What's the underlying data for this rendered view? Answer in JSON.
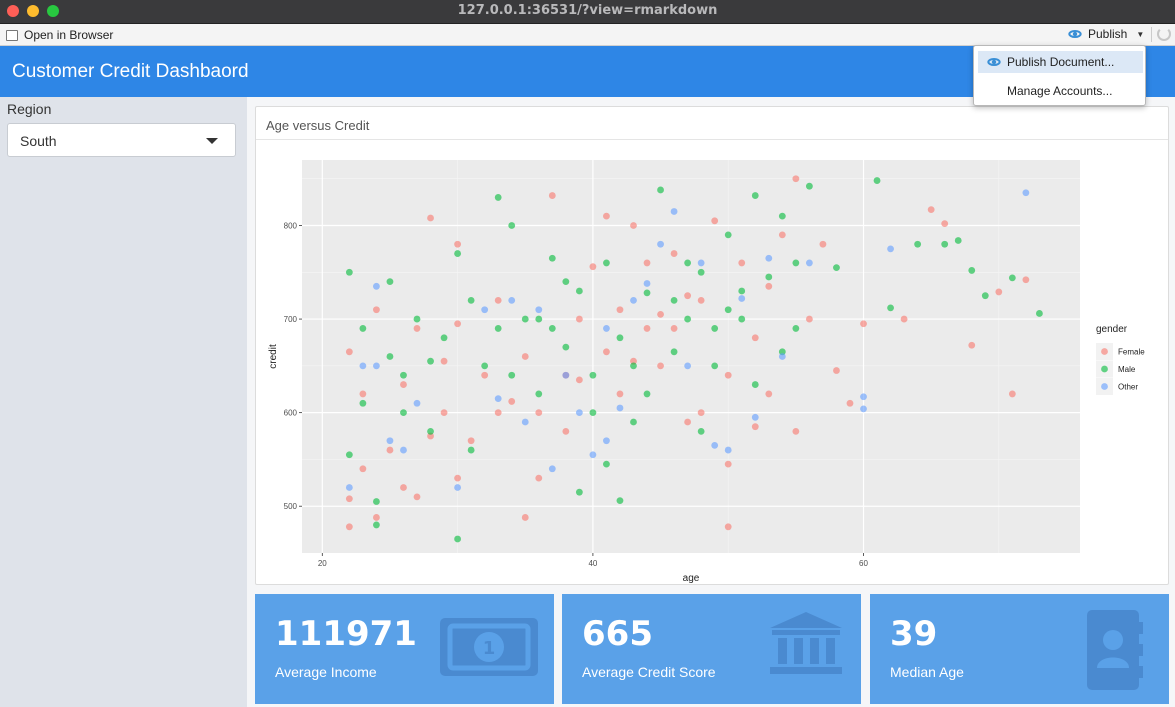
{
  "window": {
    "url": "127.0.0.1:36531/?view=rmarkdown"
  },
  "toolbar": {
    "open_browser": "Open in Browser",
    "publish": "Publish"
  },
  "publish_menu": {
    "items": [
      "Publish Document...",
      "Manage Accounts..."
    ]
  },
  "header": {
    "title": "Customer Credit Dashbaord"
  },
  "sidebar": {
    "region_label": "Region",
    "region_value": "South"
  },
  "plot_card": {
    "title": "Age versus Credit"
  },
  "value_boxes": [
    {
      "value": "111971",
      "label": "Average Income",
      "icon": "money-bill-icon"
    },
    {
      "value": "665",
      "label": "Average Credit Score",
      "icon": "bank-icon"
    },
    {
      "value": "39",
      "label": "Median Age",
      "icon": "address-book-icon"
    }
  ],
  "colors": {
    "header": "#2e86e6",
    "value_box": "#5aa1e8",
    "female": "#f8766d",
    "male": "#00ba38",
    "other": "#619cff"
  },
  "chart_data": {
    "type": "scatter",
    "xlabel": "age",
    "ylabel": "credit",
    "xlim": [
      18.5,
      76
    ],
    "ylim": [
      450,
      870
    ],
    "x_ticks": [
      20,
      40,
      60
    ],
    "y_ticks": [
      500,
      600,
      700,
      800
    ],
    "grid": true,
    "legend": {
      "title": "gender",
      "position": "right",
      "entries": [
        "Female",
        "Male",
        "Other"
      ]
    },
    "series": [
      {
        "name": "Female",
        "points": [
          [
            22,
            478
          ],
          [
            22,
            508
          ],
          [
            23,
            540
          ],
          [
            24,
            488
          ],
          [
            25,
            560
          ],
          [
            26,
            520
          ],
          [
            27,
            510
          ],
          [
            28,
            808
          ],
          [
            28,
            575
          ],
          [
            29,
            655
          ],
          [
            30,
            780
          ],
          [
            30,
            695
          ],
          [
            32,
            640
          ],
          [
            33,
            720
          ],
          [
            34,
            612
          ],
          [
            35,
            488
          ],
          [
            36,
            530
          ],
          [
            37,
            832
          ],
          [
            38,
            580
          ],
          [
            39,
            700
          ],
          [
            40,
            756
          ],
          [
            41,
            810
          ],
          [
            42,
            620
          ],
          [
            43,
            800
          ],
          [
            44,
            690
          ],
          [
            45,
            650
          ],
          [
            46,
            770
          ],
          [
            47,
            725
          ],
          [
            48,
            600
          ],
          [
            49,
            805
          ],
          [
            50,
            545
          ],
          [
            50,
            478
          ],
          [
            51,
            760
          ],
          [
            52,
            680
          ],
          [
            53,
            620
          ],
          [
            54,
            790
          ],
          [
            55,
            850
          ],
          [
            56,
            700
          ],
          [
            57,
            780
          ],
          [
            58,
            645
          ],
          [
            59,
            610
          ],
          [
            60,
            695
          ],
          [
            63,
            700
          ],
          [
            65,
            817
          ],
          [
            66,
            802
          ],
          [
            68,
            672
          ],
          [
            70,
            729
          ],
          [
            71,
            620
          ],
          [
            72,
            742
          ],
          [
            52,
            585
          ],
          [
            26,
            630
          ],
          [
            31,
            570
          ],
          [
            35,
            660
          ],
          [
            44,
            760
          ],
          [
            47,
            590
          ],
          [
            23,
            620
          ],
          [
            30,
            530
          ],
          [
            38,
            640
          ],
          [
            42,
            710
          ],
          [
            46,
            690
          ],
          [
            55,
            580
          ],
          [
            24,
            710
          ],
          [
            33,
            600
          ],
          [
            41,
            665
          ],
          [
            48,
            720
          ],
          [
            53,
            735
          ],
          [
            36,
            600
          ],
          [
            27,
            690
          ],
          [
            45,
            705
          ],
          [
            39,
            635
          ],
          [
            22,
            665
          ],
          [
            29,
            600
          ],
          [
            43,
            655
          ],
          [
            50,
            640
          ]
        ]
      },
      {
        "name": "Male",
        "points": [
          [
            22,
            555
          ],
          [
            22,
            750
          ],
          [
            23,
            690
          ],
          [
            24,
            480
          ],
          [
            24,
            505
          ],
          [
            25,
            740
          ],
          [
            26,
            640
          ],
          [
            27,
            700
          ],
          [
            28,
            580
          ],
          [
            29,
            680
          ],
          [
            30,
            465
          ],
          [
            31,
            720
          ],
          [
            32,
            650
          ],
          [
            33,
            830
          ],
          [
            34,
            800
          ],
          [
            35,
            700
          ],
          [
            36,
            620
          ],
          [
            37,
            765
          ],
          [
            38,
            670
          ],
          [
            39,
            730
          ],
          [
            40,
            640
          ],
          [
            41,
            760
          ],
          [
            42,
            680
          ],
          [
            43,
            590
          ],
          [
            44,
            728
          ],
          [
            45,
            838
          ],
          [
            46,
            665
          ],
          [
            47,
            700
          ],
          [
            48,
            750
          ],
          [
            49,
            650
          ],
          [
            50,
            790
          ],
          [
            51,
            700
          ],
          [
            52,
            832
          ],
          [
            53,
            745
          ],
          [
            54,
            810
          ],
          [
            55,
            690
          ],
          [
            56,
            842
          ],
          [
            58,
            755
          ],
          [
            61,
            848
          ],
          [
            62,
            712
          ],
          [
            64,
            780
          ],
          [
            67,
            784
          ],
          [
            68,
            752
          ],
          [
            69,
            725
          ],
          [
            71,
            744
          ],
          [
            73,
            706
          ],
          [
            66,
            780
          ],
          [
            30,
            770
          ],
          [
            34,
            640
          ],
          [
            41,
            545
          ],
          [
            44,
            620
          ],
          [
            39,
            515
          ],
          [
            42,
            506
          ],
          [
            48,
            580
          ],
          [
            52,
            630
          ],
          [
            26,
            600
          ],
          [
            31,
            560
          ],
          [
            36,
            700
          ],
          [
            40,
            600
          ],
          [
            46,
            720
          ],
          [
            50,
            710
          ],
          [
            54,
            665
          ],
          [
            23,
            610
          ],
          [
            28,
            655
          ],
          [
            33,
            690
          ],
          [
            38,
            740
          ],
          [
            43,
            650
          ],
          [
            47,
            760
          ],
          [
            51,
            730
          ],
          [
            55,
            760
          ],
          [
            25,
            660
          ],
          [
            37,
            690
          ],
          [
            49,
            690
          ]
        ]
      },
      {
        "name": "Other",
        "points": [
          [
            22,
            520
          ],
          [
            23,
            650
          ],
          [
            24,
            735
          ],
          [
            25,
            570
          ],
          [
            26,
            560
          ],
          [
            27,
            610
          ],
          [
            30,
            520
          ],
          [
            32,
            710
          ],
          [
            34,
            720
          ],
          [
            35,
            590
          ],
          [
            36,
            710
          ],
          [
            37,
            540
          ],
          [
            38,
            640
          ],
          [
            39,
            600
          ],
          [
            40,
            555
          ],
          [
            41,
            570
          ],
          [
            42,
            605
          ],
          [
            43,
            720
          ],
          [
            44,
            738
          ],
          [
            45,
            780
          ],
          [
            46,
            815
          ],
          [
            47,
            650
          ],
          [
            48,
            760
          ],
          [
            49,
            565
          ],
          [
            50,
            560
          ],
          [
            51,
            722
          ],
          [
            52,
            595
          ],
          [
            53,
            765
          ],
          [
            54,
            660
          ],
          [
            56,
            760
          ],
          [
            60,
            617
          ],
          [
            60,
            604
          ],
          [
            62,
            775
          ],
          [
            72,
            835
          ],
          [
            24,
            650
          ],
          [
            33,
            615
          ],
          [
            41,
            690
          ]
        ]
      }
    ]
  }
}
